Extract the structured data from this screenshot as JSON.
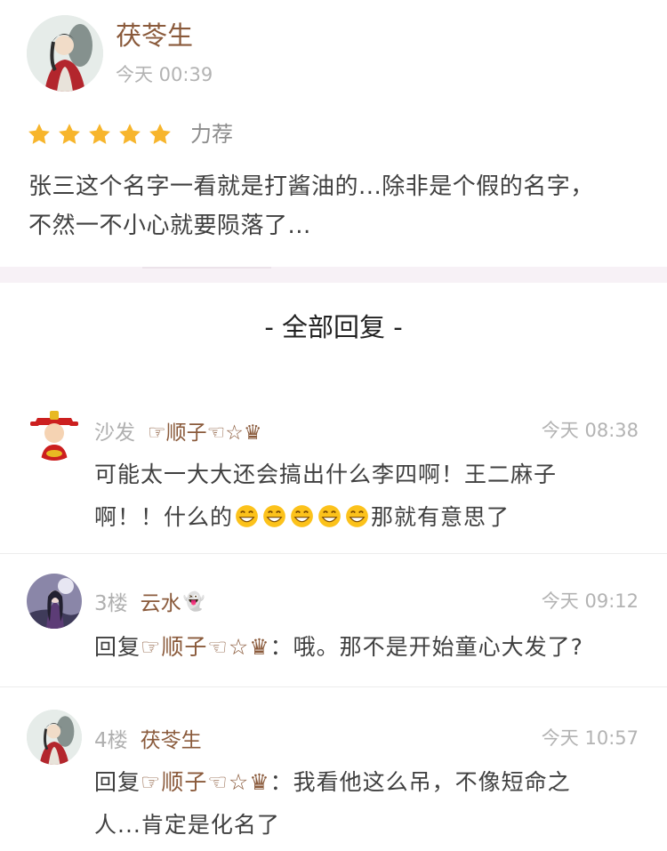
{
  "review": {
    "author": "茯苓生",
    "time": "今天 00:39",
    "stars": 5,
    "rating_label": "力荐",
    "line1": "张三这个名字一看就是打酱油的...除非是个假的名字，",
    "line2": "不然一不小心就要陨落了...",
    "accent_color": "#8a5a3b",
    "star_color": "#f7b52c"
  },
  "replies_heading": "- 全部回复 -",
  "replies": [
    {
      "floor": "沙发",
      "user": "☞顺子☜☆♛",
      "time": "今天 08:38",
      "line1": "可能太一大大还会搞出什么李四啊！王二麻子",
      "line2_start": "啊！！什么的",
      "emoji_name": "grinning-face-emoji",
      "emoji_count": 5,
      "line2_end": "那就有意思了"
    },
    {
      "floor": "3楼",
      "user": "云水",
      "user_badge": "👻",
      "time": "今天 09:12",
      "reply_prefix": "回复",
      "reply_to": "☞顺子☜☆♛",
      "text": "：哦。那不是开始童心大发了?"
    },
    {
      "floor": "4楼",
      "user": "茯苓生",
      "time": "今天 10:57",
      "reply_prefix": "回复",
      "reply_to": "☞顺子☜☆♛",
      "text_line1": "：我看他这么吊，不像短命之",
      "text_line2": "人...肯定是化名了"
    }
  ]
}
